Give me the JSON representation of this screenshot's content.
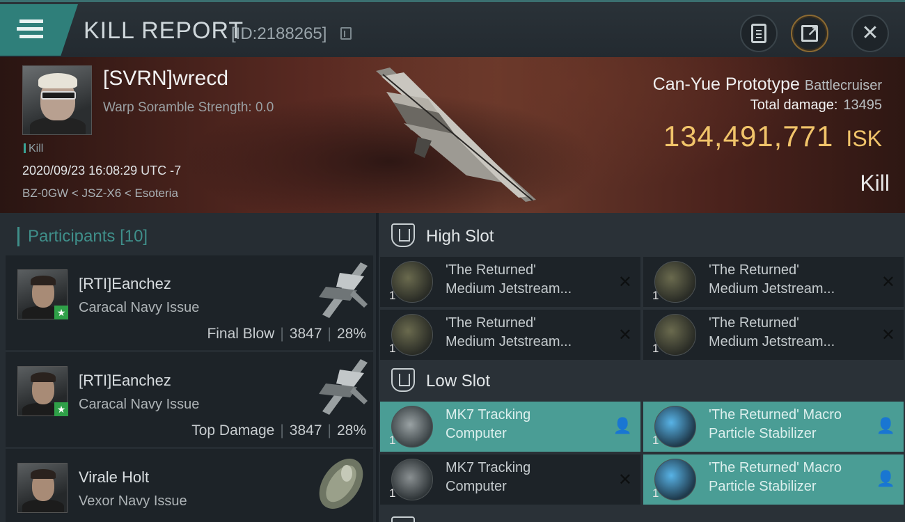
{
  "header": {
    "title": "KILL REPORT",
    "id_text": "[ID:2188265]"
  },
  "victim": {
    "name": "[SVRN]wrecd",
    "scramble": "Warp Soramble Strength: 0.0",
    "tag": "Kill",
    "time": "2020/09/23 16:08:29 UTC -7",
    "location": "BZ-0GW < JSZ-X6 < Esoteria",
    "ship_name": "Can-Yue Prototype",
    "ship_class": "Battlecruiser",
    "damage_label": "Total damage:",
    "damage_value": "13495",
    "isk_value": "134,491,771",
    "isk_unit": "ISK",
    "result": "Kill"
  },
  "participants": {
    "label": "Participants",
    "count": "[10]",
    "rows": [
      {
        "name": "[RTI]Eanchez",
        "ship": "Caracal Navy Issue",
        "role": "Final Blow",
        "damage": "3847",
        "percent": "28%"
      },
      {
        "name": "[RTI]Eanchez",
        "ship": "Caracal Navy Issue",
        "role": "Top Damage",
        "damage": "3847",
        "percent": "28%"
      },
      {
        "name": "Virale Holt",
        "ship": "Vexor Navy Issue"
      }
    ]
  },
  "slots": {
    "high": {
      "label": "High Slot",
      "modules": [
        {
          "qty": "1",
          "line1": "'The Returned'",
          "line2": "Medium Jetstream...",
          "status": "destroyed-icon"
        },
        {
          "qty": "1",
          "line1": "'The Returned'",
          "line2": "Medium Jetstream...",
          "status": "destroyed-icon"
        },
        {
          "qty": "1",
          "line1": "'The Returned'",
          "line2": "Medium Jetstream...",
          "status": "destroyed-icon"
        },
        {
          "qty": "1",
          "line1": "'The Returned'",
          "line2": "Medium Jetstream...",
          "status": "destroyed-icon"
        }
      ]
    },
    "low": {
      "label": "Low Slot",
      "modules": [
        {
          "qty": "1",
          "line1": "MK7 Tracking",
          "line2": "Computer",
          "status": "dropped-icon"
        },
        {
          "qty": "1",
          "line1": "'The Returned' Macro",
          "line2": "Particle Stabilizer",
          "status": "dropped-icon"
        },
        {
          "qty": "1",
          "line1": "MK7 Tracking",
          "line2": "Computer",
          "status": "destroyed-icon"
        },
        {
          "qty": "1",
          "line1": "'The Returned' Macro",
          "line2": "Particle Stabilizer",
          "status": "dropped-icon"
        }
      ]
    }
  },
  "colors": {
    "accent_teal": "#3f8f8a",
    "dropped_bg": "#4a9d95",
    "isk_gold": "#f1c46a"
  }
}
